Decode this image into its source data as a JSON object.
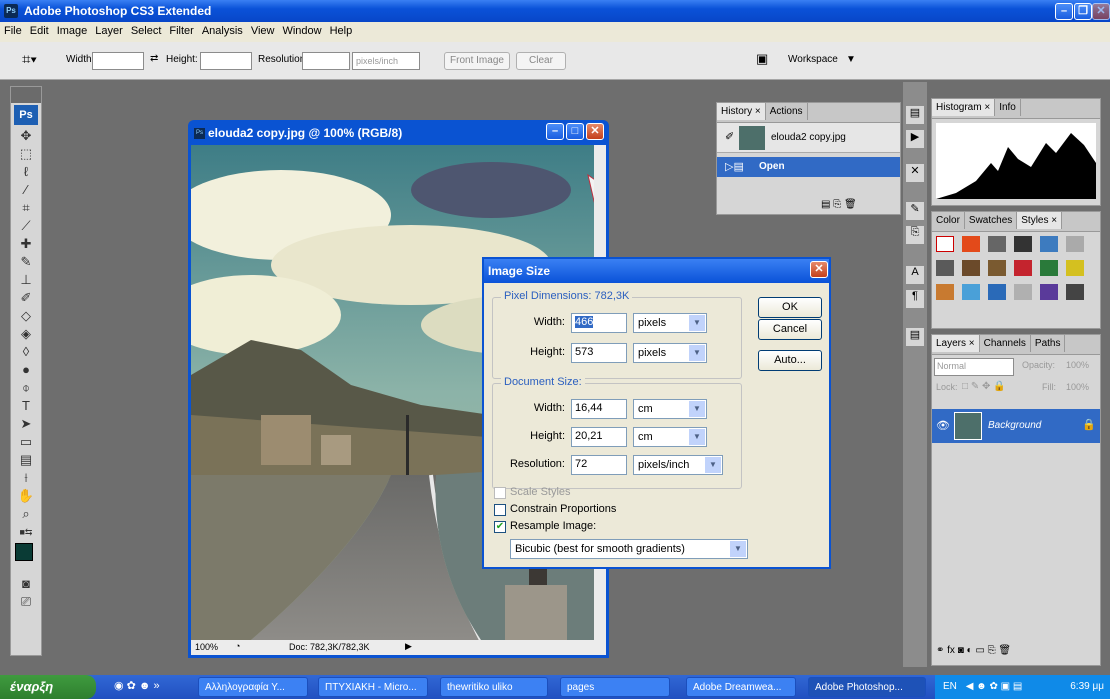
{
  "app": {
    "title": "Adobe Photoshop CS3 Extended",
    "ps_badge": "Ps"
  },
  "menu": [
    "File",
    "Edit",
    "Image",
    "Layer",
    "Select",
    "Filter",
    "Analysis",
    "View",
    "Window",
    "Help"
  ],
  "options": {
    "width_label": "Width:",
    "height_label": "Height:",
    "resolution_label": "Resolution:",
    "units": "pixels/inch",
    "front_image": "Front Image",
    "clear": "Clear",
    "workspace": "Workspace"
  },
  "toolbox": {
    "logo": "Ps"
  },
  "document": {
    "title": "elouda2 copy.jpg @ 100% (RGB/8)",
    "zoom": "100%",
    "doc_size": "Doc: 782,3K/782,3K"
  },
  "dialog": {
    "title": "Image Size",
    "pixel_dimensions": "Pixel Dimensions: 782,3K",
    "px_width_label": "Width:",
    "px_width": "466",
    "px_width_unit": "pixels",
    "px_height_label": "Height:",
    "px_height": "573",
    "px_height_unit": "pixels",
    "document_size": "Document Size:",
    "doc_width_label": "Width:",
    "doc_width": "16,44",
    "doc_width_unit": "cm",
    "doc_height_label": "Height:",
    "doc_height": "20,21",
    "doc_height_unit": "cm",
    "resolution_label": "Resolution:",
    "resolution": "72",
    "resolution_unit": "pixels/inch",
    "scale_styles": "Scale Styles",
    "constrain": "Constrain Proportions",
    "resample": "Resample Image:",
    "resample_method": "Bicubic (best for smooth gradients)",
    "ok": "OK",
    "cancel": "Cancel",
    "auto": "Auto..."
  },
  "history": {
    "tab1": "History ×",
    "tab2": "Actions",
    "snapshot": "elouda2 copy.jpg",
    "step": "Open"
  },
  "histogram": {
    "tab1": "Histogram ×",
    "tab2": "Info"
  },
  "styles": {
    "tab1": "Color",
    "tab2": "Swatches",
    "tab3": "Styles ×"
  },
  "layers": {
    "tab1": "Layers ×",
    "tab2": "Channels",
    "tab3": "Paths",
    "blend": "Normal",
    "opacity_label": "Opacity:",
    "opacity": "100%",
    "lock_label": "Lock:",
    "fill_label": "Fill:",
    "fill": "100%",
    "layer_name": "Background"
  },
  "taskbar": {
    "start": "έναρξη",
    "tasks": [
      "Αλληλογραφία Υ...",
      "ΠΤΥΧΙΑΚΗ - Micro...",
      "thewritiko uliko",
      "pages",
      "Adobe Dreamwea...",
      "Adobe Photoshop..."
    ],
    "lang": "EN",
    "clock": "6:39 μμ"
  }
}
